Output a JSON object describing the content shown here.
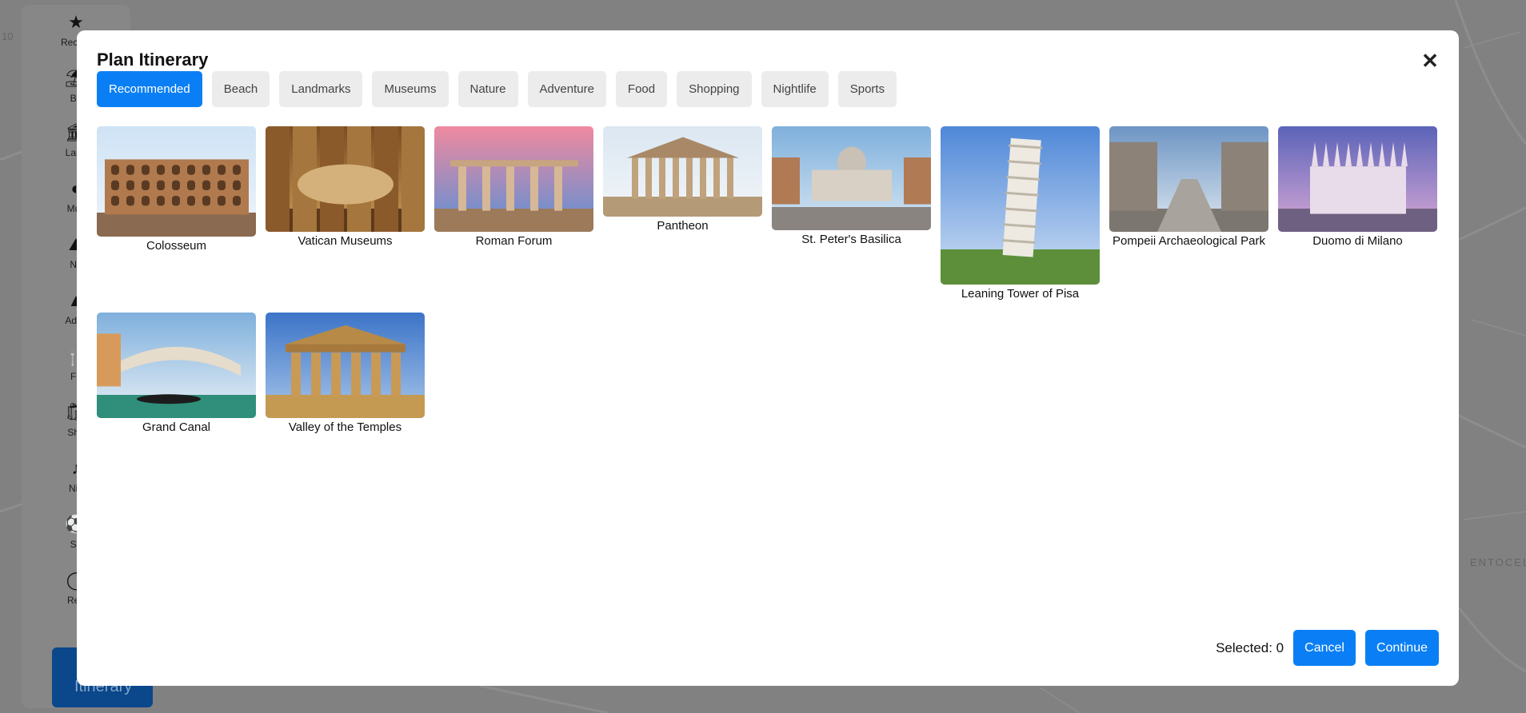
{
  "background": {
    "map_label": "ENTOCELLE",
    "corner_label": "10"
  },
  "sidebar": {
    "items": [
      {
        "icon": "star-icon",
        "glyph": "★",
        "label": "Recom"
      },
      {
        "icon": "beach-icon",
        "glyph": "⛱",
        "label": "Be"
      },
      {
        "icon": "landmark-icon",
        "glyph": "🏛",
        "label": "Land"
      },
      {
        "icon": "museum-icon",
        "glyph": "◐",
        "label": "Mus"
      },
      {
        "icon": "nature-icon",
        "glyph": "⛰",
        "label": "Na"
      },
      {
        "icon": "adventure-icon",
        "glyph": "▲",
        "label": "Adve"
      },
      {
        "icon": "food-icon",
        "glyph": "🍴",
        "label": "Fo"
      },
      {
        "icon": "shopping-icon",
        "glyph": "🛍",
        "label": "Sho"
      },
      {
        "icon": "nightlife-icon",
        "glyph": "♪",
        "label": "Nig"
      },
      {
        "icon": "sports-icon",
        "glyph": "⚽",
        "label": "Sp"
      },
      {
        "icon": "rent-icon",
        "glyph": "◯",
        "label": "Ren"
      }
    ],
    "plan_button": "Plan Itinerary"
  },
  "modal": {
    "title": "Plan Itinerary",
    "close_icon": "close-icon",
    "tabs": [
      {
        "label": "Recommended",
        "active": true
      },
      {
        "label": "Beach",
        "active": false
      },
      {
        "label": "Landmarks",
        "active": false
      },
      {
        "label": "Museums",
        "active": false
      },
      {
        "label": "Nature",
        "active": false
      },
      {
        "label": "Adventure",
        "active": false
      },
      {
        "label": "Food",
        "active": false
      },
      {
        "label": "Shopping",
        "active": false
      },
      {
        "label": "Nightlife",
        "active": false
      },
      {
        "label": "Sports",
        "active": false
      }
    ],
    "places": [
      {
        "name": "Colosseum"
      },
      {
        "name": "Vatican Museums"
      },
      {
        "name": "Roman Forum"
      },
      {
        "name": "Pantheon"
      },
      {
        "name": "St. Peter's Basilica"
      },
      {
        "name": "Leaning Tower of Pisa"
      },
      {
        "name": "Pompeii Archaeological Park"
      },
      {
        "name": "Duomo di Milano"
      },
      {
        "name": "Grand Canal"
      },
      {
        "name": "Valley of the Temples"
      }
    ],
    "footer": {
      "selected_label": "Selected: 0",
      "cancel": "Cancel",
      "continue": "Continue"
    }
  }
}
